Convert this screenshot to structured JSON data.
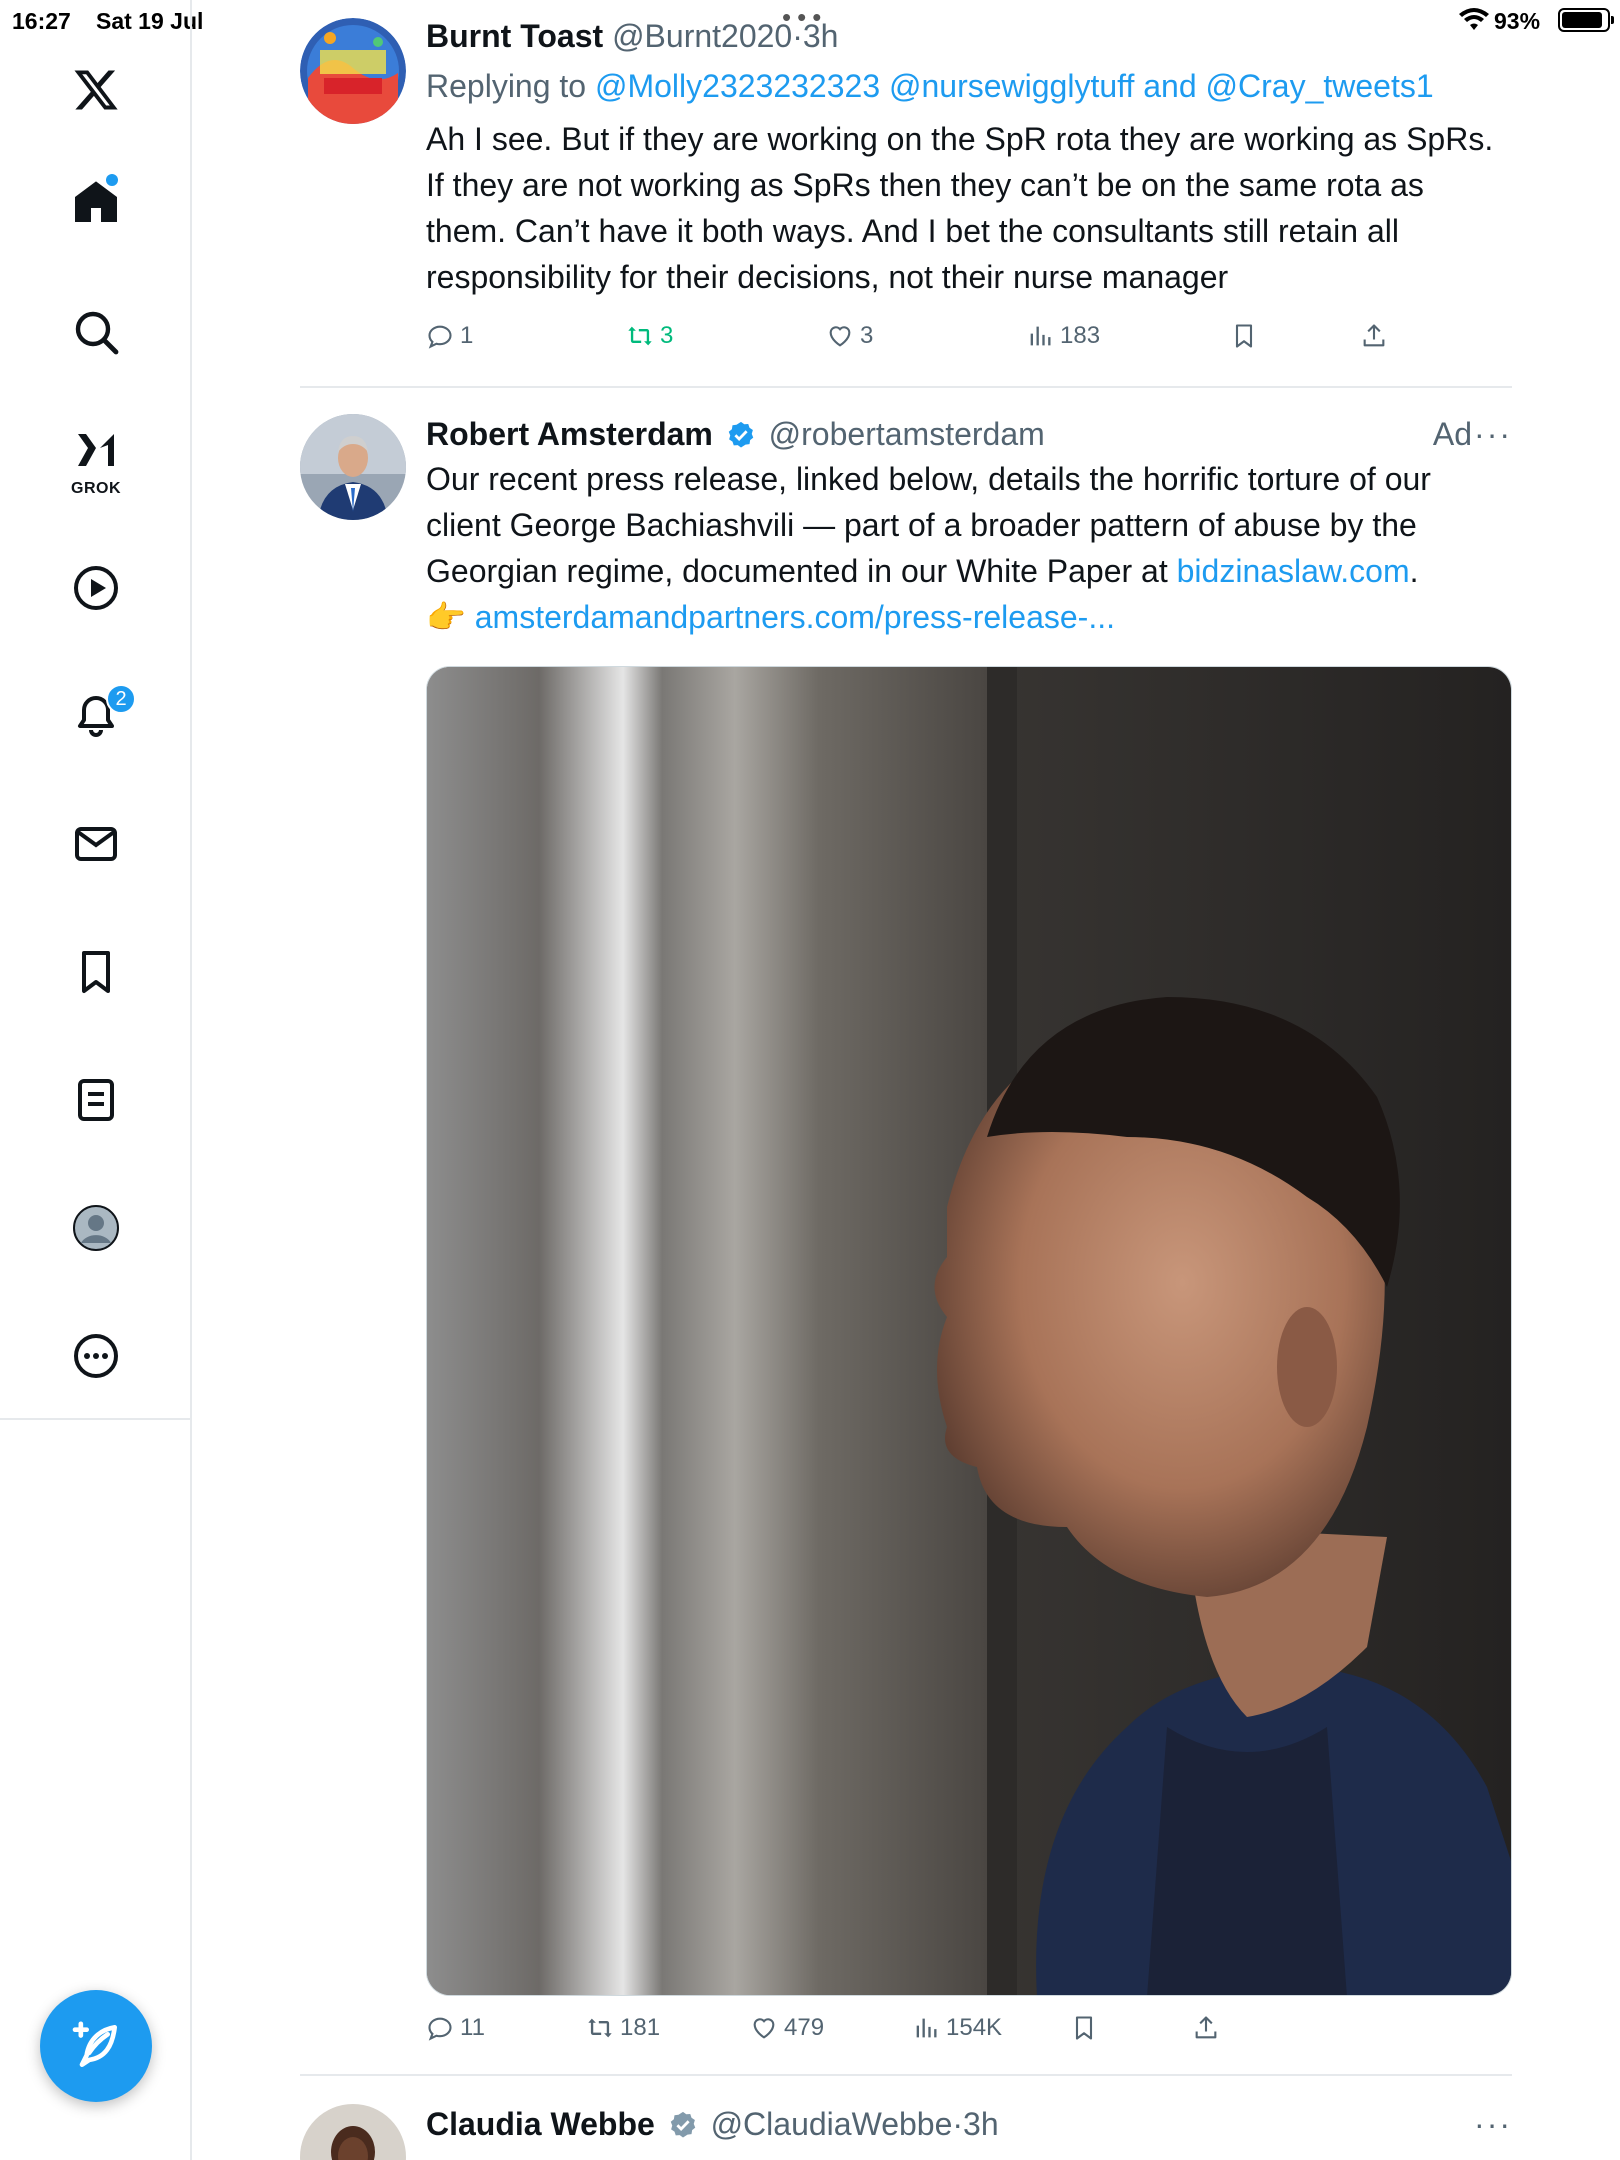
{
  "status_bar": {
    "time": "16:27",
    "date": "Sat 19 Jul",
    "battery": "93%"
  },
  "sidebar": {
    "logo_icon": "x-logo-icon",
    "items": [
      {
        "name": "home",
        "icon": "home-icon",
        "has_dot": true
      },
      {
        "name": "search",
        "icon": "search-icon"
      },
      {
        "name": "grok",
        "icon": "grok-icon",
        "label": "GROK"
      },
      {
        "name": "video",
        "icon": "play-icon"
      },
      {
        "name": "notifications",
        "icon": "bell-icon",
        "badge": "2"
      },
      {
        "name": "messages",
        "icon": "mail-icon"
      },
      {
        "name": "bookmarks",
        "icon": "bookmark-icon"
      },
      {
        "name": "lists",
        "icon": "list-icon"
      },
      {
        "name": "profile",
        "icon": "profile-icon"
      },
      {
        "name": "more",
        "icon": "more-circle-icon"
      }
    ],
    "compose_icon": "compose-icon"
  },
  "tweets": [
    {
      "name": "Burnt Toast",
      "handle": "@Burnt2020",
      "time_sep": "·",
      "time": "3h",
      "reply_prefix": "Replying to",
      "reply_mentions": "@Molly2323232323 @nursewigglytuff and @Cray_tweets1",
      "text": "Ah I see. But if they are working on the SpR rota they are working as SpRs. If they are not working as SpRs then they can’t be on the same rota as them. Can’t have it both ways. And I bet the consultants still retain all responsibility for their decisions, not their nurse manager",
      "replies": "1",
      "retweets": "3",
      "likes": "3",
      "views": "183"
    },
    {
      "name": "Robert Amsterdam",
      "handle": "@robertamsterdam",
      "ad_label": "Ad",
      "text_1": "Our recent press release, linked below, details the horrific torture of our client George Bachiashvili — part of a broader pattern of abuse by the Georgian regime, documented in our White Paper at ",
      "text_link_1": "bidzinaslaw.com",
      "text_2": ".",
      "text_emoji": "👉",
      "text_link_2": "amsterdamandpartners.com/press-release-...",
      "replies": "11",
      "retweets": "181",
      "likes": "479",
      "views": "154K"
    },
    {
      "name": "Claudia Webbe",
      "handle": "@ClaudiaWebbe",
      "time_sep": "·",
      "time": "3h"
    }
  ],
  "colors": {
    "accent": "#1d9bf0",
    "retweet_active": "#00ba7c",
    "secondary_text": "#536471",
    "verified_blue": "#1d9bf0",
    "verified_gray": "#829aab"
  }
}
